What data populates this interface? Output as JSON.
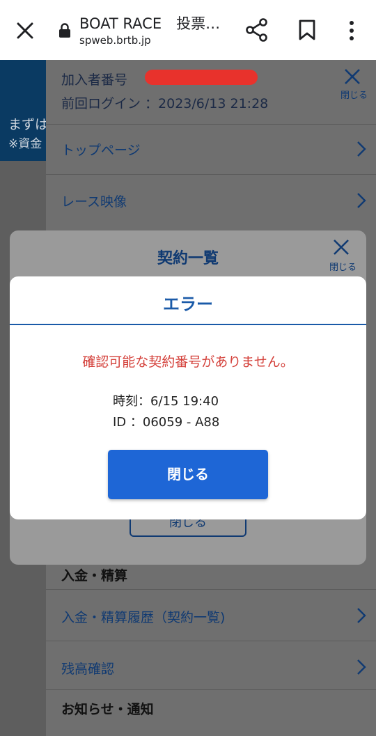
{
  "browser": {
    "title": "BOAT RACE　投票…",
    "url": "spweb.brtb.jp"
  },
  "background": {
    "text1": "まずは",
    "text2": "※資金"
  },
  "menu": {
    "member_label": "加入者番号",
    "last_login": "前回ログイン ：2023/6/13 21:28",
    "close_label": "閉じる",
    "items": [
      {
        "label": "トップページ"
      },
      {
        "label": "レース映像"
      }
    ],
    "section_deposit": "入金・精算",
    "deposit_items": [
      {
        "label": "入金・精算履歴（契約一覧)"
      },
      {
        "label": "残高確認"
      }
    ],
    "section_notice": "お知らせ・通知"
  },
  "contract_modal": {
    "title": "契約一覧",
    "close_label": "閉じる",
    "bottom_button": "閉じる"
  },
  "error_dialog": {
    "title": "エラー",
    "message": "確認可能な契約番号がありません。",
    "time_line": "時刻：6/15 19:40",
    "id_line": "ID ：06059 - A88",
    "close_button": "閉じる"
  },
  "colors": {
    "accent": "#1e66d6",
    "error_text": "#d4403a",
    "title_blue": "#1a5aa8"
  }
}
